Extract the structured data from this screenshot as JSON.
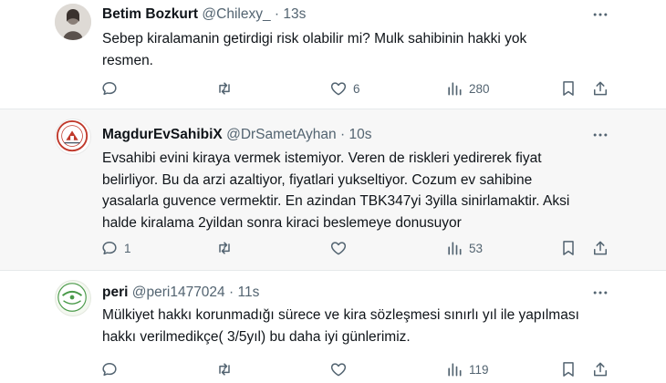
{
  "tweets": [
    {
      "name": "Betim Bozkurt",
      "handle": "@Chilexy_",
      "time": "13s",
      "text_lines": [
        "Sebep kiralamanin getirdigi risk olabilir mi? Mulk sahibinin hakki yok",
        "resmen."
      ],
      "replies": "",
      "retweets": "",
      "likes": "6",
      "views": "280"
    },
    {
      "name": "MagdurEvSahibiX",
      "handle": "@DrSametAyhan",
      "time": "10s",
      "text_lines": [
        "Evsahibi evini kiraya vermek istemiyor. Veren de riskleri yedirerek fiyat",
        "belirliyor. Bu da arzi azaltiyor, fiyatlari yukseltiyor. Cozum ev sahibine",
        "yasalarla guvence vermektir. En azindan TBK347yi 3yilla sinirlamaktir. Aksi",
        "halde kiralama 2yildan sonra kiraci beslemeye donusuyor"
      ],
      "replies": "1",
      "retweets": "",
      "likes": "",
      "views": "53"
    },
    {
      "name": "peri",
      "handle": "@peri1477024",
      "time": "11s",
      "text_lines": [
        "Mülkiyet hakkı korunmadığı sürece ve kira sözleşmesi sınırlı yıl ile yapılması",
        "hakkı verilmedikçe( 3/5yıl) bu daha iyi günlerimiz."
      ],
      "replies": "",
      "retweets": "",
      "likes": "",
      "views": "119"
    }
  ],
  "separator": "·",
  "colors": {
    "text": "#0f1419",
    "muted": "#536471",
    "highlight_bg": "#f7f7f7",
    "divider": "#e6e9eb"
  },
  "icons": [
    "reply-icon",
    "retweet-icon",
    "like-icon",
    "views-icon",
    "bookmark-icon",
    "share-icon",
    "more-icon"
  ]
}
